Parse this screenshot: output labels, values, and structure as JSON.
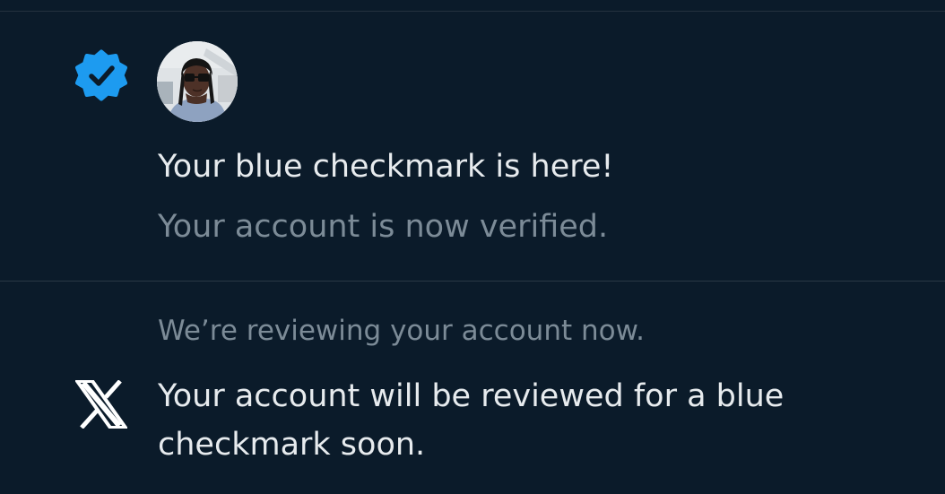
{
  "colors": {
    "background": "#0b1b2a",
    "verified_blue": "#1d9bf0",
    "primary_text": "#e7ebee",
    "secondary_text": "#7c8b97",
    "divider": "#2a3845"
  },
  "notifications": [
    {
      "icon": "verified-badge-icon",
      "avatar": "user-avatar",
      "title": "Your blue checkmark is here!",
      "subtitle": "Your account is now verified."
    },
    {
      "icon": "x-logo-icon",
      "status": "We’re reviewing your account now.",
      "message": "Your account will be reviewed for a blue checkmark soon."
    }
  ]
}
